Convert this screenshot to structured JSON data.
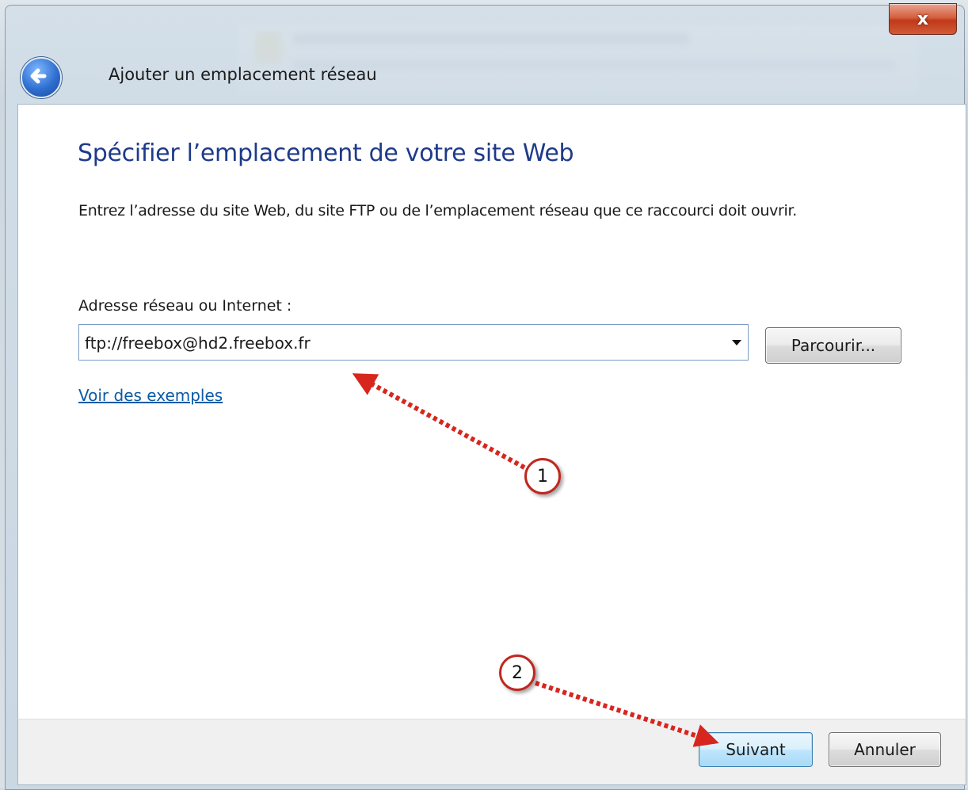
{
  "window": {
    "title": "Ajouter un emplacement réseau",
    "close_label": "x"
  },
  "page": {
    "heading": "Spécifier l’emplacement de votre site Web",
    "instruction": "Entrez l’adresse du site Web, du site FTP ou de l’emplacement réseau que ce raccourci doit ouvrir.",
    "field_label": "Adresse réseau ou Internet :",
    "address_value": "ftp://freebox@hd2.freebox.fr",
    "browse_label": "Parcourir...",
    "examples_link": "Voir des exemples"
  },
  "footer": {
    "next_label": "Suivant",
    "cancel_label": "Annuler"
  },
  "annotations": {
    "step1": "1",
    "step2": "2",
    "arrow_color": "#d7261e"
  },
  "colors": {
    "heading": "#1e3a8a",
    "link": "#0b5aa6",
    "close_button": "#c0391a",
    "default_button_border": "#3c7fb1"
  },
  "icons": {
    "back": "back-arrow-icon",
    "dropdown": "chevron-down-icon",
    "close": "close-icon"
  }
}
